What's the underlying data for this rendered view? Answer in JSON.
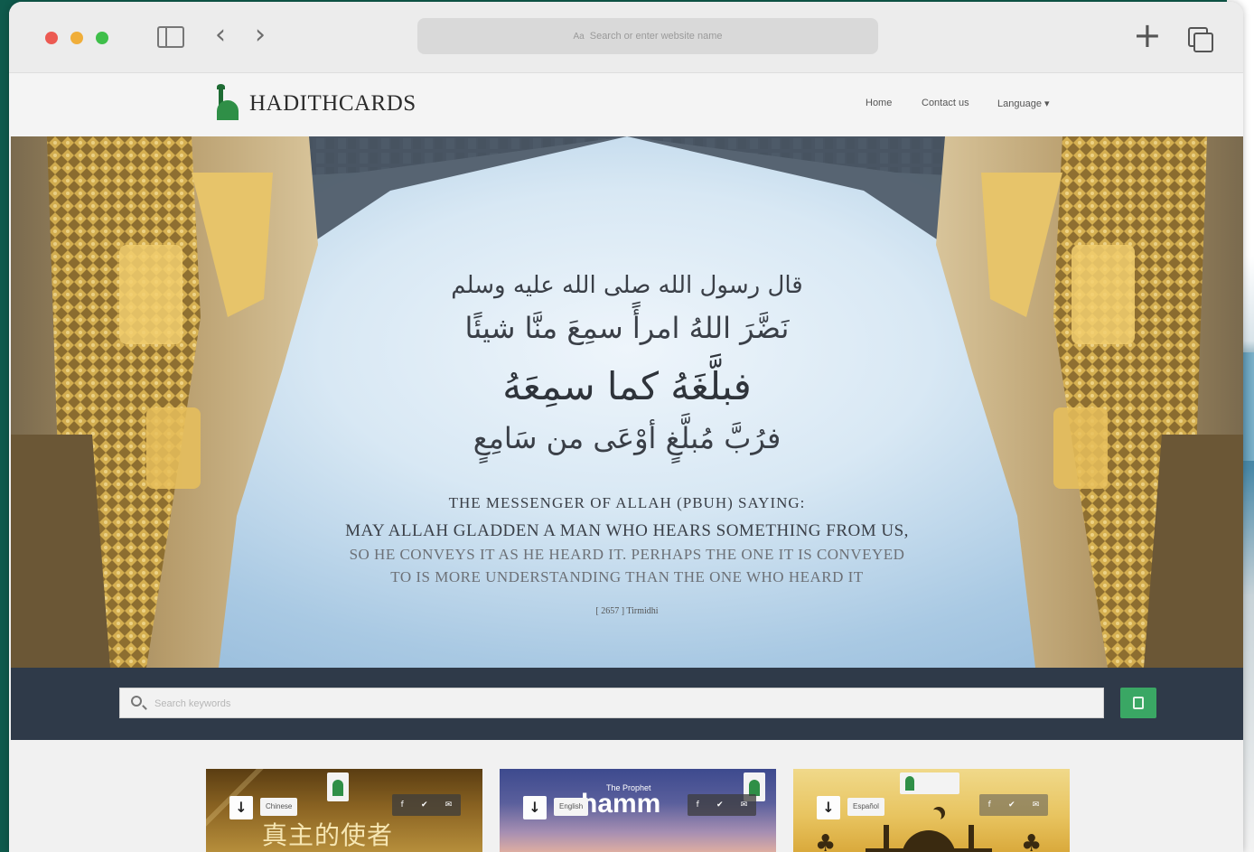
{
  "browser": {
    "url_placeholder": "Search or enter website name",
    "url_prefix": "Aa",
    "back_glyph": "‹",
    "forward_glyph": "›",
    "new_tab_glyph": "+"
  },
  "site": {
    "logo_text": "HADITHCARDS",
    "nav": {
      "home": "Home",
      "contact": "Contact us",
      "language": "Language ▾"
    }
  },
  "hero": {
    "arabic_line1": "قال رسول الله صلى الله عليه وسلم",
    "arabic_line2": "نَضَّرَ اللهُ امرأً سمِعَ منَّا شيئًا",
    "arabic_line3": "فبلَّغَهُ كما سمِعَهُ",
    "arabic_line4": "فرُبَّ مُبلَّغٍ أوْعَى من سَامِعٍ",
    "english_heading": "THE MESSENGER OF ALLAH (PBUH) SAYING:",
    "english_line1": "MAY ALLAH GLADDEN A MAN WHO HEARS SOMETHING FROM US,",
    "english_line2": "SO HE CONVEYS IT AS HE HEARD IT. PERHAPS THE ONE IT IS CONVEYED",
    "english_line3": "TO IS MORE UNDERSTANDING THAN THE ONE WHO HEARD IT",
    "source": "[ 2657 ] Tirmidhi"
  },
  "search": {
    "placeholder": "Search keywords"
  },
  "cards": [
    {
      "language": "Chinese",
      "title": "真主的使者",
      "download": "↓",
      "share": [
        "f",
        "✔",
        "✉"
      ]
    },
    {
      "language": "English",
      "kicker": "The Prophet",
      "title": "hamm",
      "download": "↓",
      "share": [
        "f",
        "✔",
        "✉"
      ]
    },
    {
      "language": "Español",
      "download": "↓",
      "share": [
        "f",
        "✔",
        "✉"
      ]
    }
  ],
  "colors": {
    "brand_green": "#3aa764",
    "search_band": "#2f3a49",
    "page_background": "#0f5a4c"
  }
}
